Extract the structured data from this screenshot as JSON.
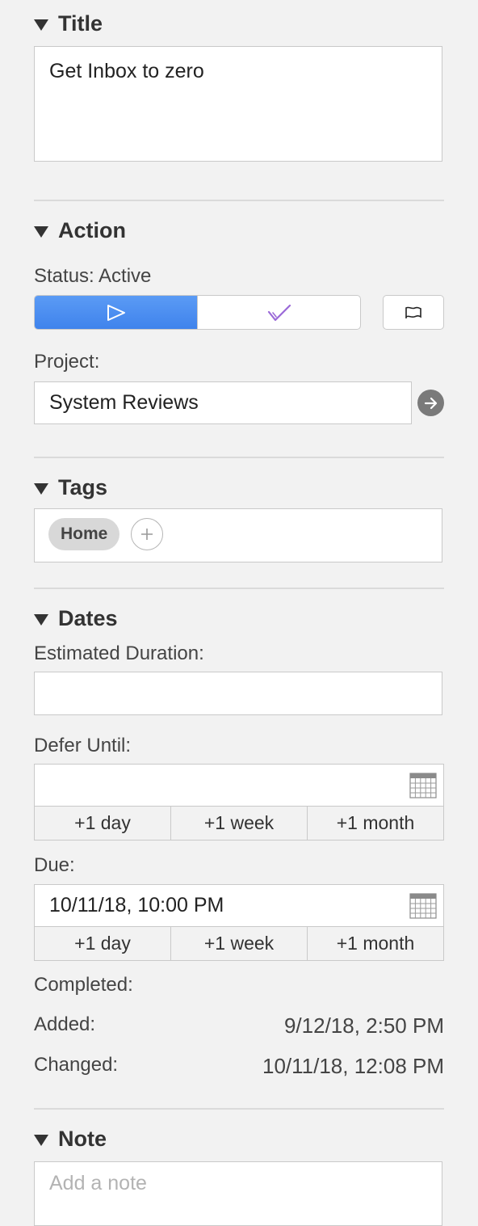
{
  "sections": {
    "title": "Title",
    "action": "Action",
    "tags": "Tags",
    "dates": "Dates",
    "note": "Note"
  },
  "title_field": {
    "value": "Get Inbox to zero"
  },
  "action": {
    "status_label": "Status: Active",
    "project_label": "Project:",
    "project_value": "System Reviews",
    "status_active_color": "#4a8ef0"
  },
  "tags": {
    "items": [
      "Home"
    ]
  },
  "dates": {
    "estimated_label": "Estimated Duration:",
    "estimated_value": "",
    "defer_label": "Defer Until:",
    "defer_value": "",
    "due_label": "Due:",
    "due_value": "10/11/18, 10:00 PM",
    "quick": [
      "+1 day",
      "+1 week",
      "+1 month"
    ],
    "completed_label": "Completed:",
    "added_label": "Added:",
    "added_value": "9/12/18, 2:50 PM",
    "changed_label": "Changed:",
    "changed_value": "10/11/18, 12:08 PM"
  },
  "note": {
    "placeholder": "Add a note"
  }
}
